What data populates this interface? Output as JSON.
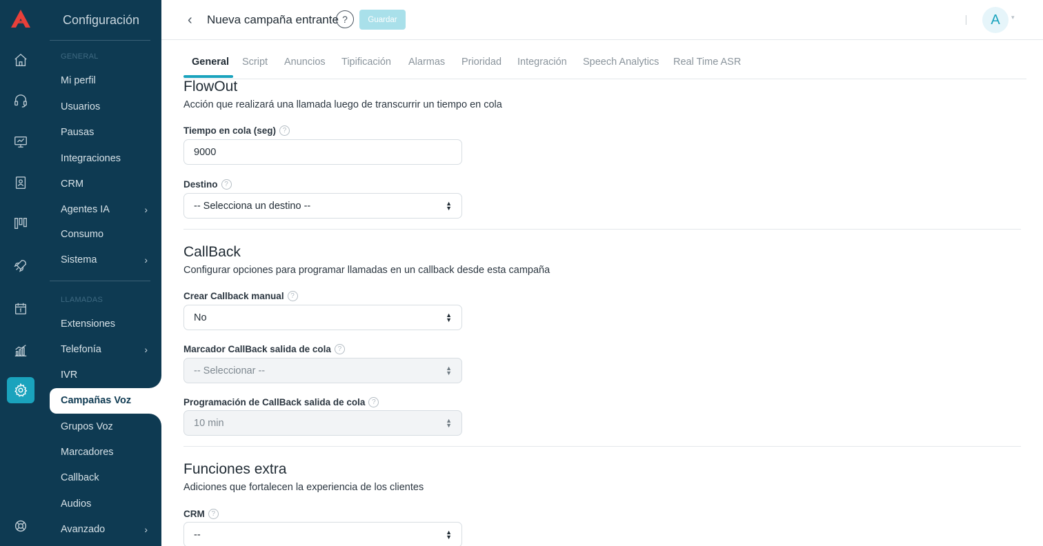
{
  "sidebar": {
    "title": "Configuración",
    "section_general": "GENERAL",
    "section_llamadas": "LLAMADAS",
    "general_items": [
      {
        "label": "Mi perfil",
        "chevron": false
      },
      {
        "label": "Usuarios",
        "chevron": false
      },
      {
        "label": "Pausas",
        "chevron": false
      },
      {
        "label": "Integraciones",
        "chevron": false
      },
      {
        "label": "CRM",
        "chevron": false
      },
      {
        "label": "Agentes IA",
        "chevron": true
      },
      {
        "label": "Consumo",
        "chevron": false
      },
      {
        "label": "Sistema",
        "chevron": true
      }
    ],
    "llamadas_items": [
      {
        "label": "Extensiones",
        "chevron": false
      },
      {
        "label": "Telefonía",
        "chevron": true
      },
      {
        "label": "IVR",
        "chevron": false
      },
      {
        "label": "Campañas Voz",
        "chevron": false,
        "active": true
      },
      {
        "label": "Grupos Voz",
        "chevron": false
      },
      {
        "label": "Marcadores",
        "chevron": false
      },
      {
        "label": "Callback",
        "chevron": false
      },
      {
        "label": "Audios",
        "chevron": false
      },
      {
        "label": "Avanzado",
        "chevron": true
      }
    ],
    "chevron_glyph": "›"
  },
  "rail_icons": [
    "home-icon",
    "headset-icon",
    "monitor-icon",
    "contacts-icon",
    "kanban-icon",
    "rocket-icon",
    "calendar-icon",
    "chart-icon",
    "gear-icon",
    "support-icon"
  ],
  "header": {
    "back_glyph": "‹",
    "title": "Nueva campaña entrante",
    "help_glyph": "?",
    "save_label": "Guardar",
    "avatar_letter": "A",
    "caret": "▾"
  },
  "tabs": [
    {
      "label": "General",
      "active": true
    },
    {
      "label": "Script"
    },
    {
      "label": "Anuncios"
    },
    {
      "label": "Tipificación"
    },
    {
      "label": "Alarmas"
    },
    {
      "label": "Prioridad"
    },
    {
      "label": "Integración"
    },
    {
      "label": "Speech Analytics"
    },
    {
      "label": "Real Time ASR"
    }
  ],
  "flowout": {
    "title": "FlowOut",
    "description": "Acción que realizará una llamada luego de transcurrir un tiempo en cola",
    "queue_time_label": "Tiempo en cola (seg)",
    "queue_time_value": "9000",
    "destino_label": "Destino",
    "destino_value": "-- Selecciona un destino --"
  },
  "callback": {
    "title": "CallBack",
    "description": "Configurar opciones para programar llamadas en un callback desde esta campaña",
    "manual_label": "Crear Callback manual",
    "manual_value": "No",
    "marcador_label": "Marcador CallBack salida de cola",
    "marcador_value": "-- Seleccionar --",
    "programacion_label": "Programación de CallBack salida de cola",
    "programacion_value": "10 min"
  },
  "extra": {
    "title": "Funciones extra",
    "description": "Adiciones que fortalecen la experiencia de los clientes",
    "crm_label": "CRM",
    "crm_value": "--"
  },
  "help_glyph": "?",
  "colors": {
    "sidebar_bg": "#0e3a52",
    "accent": "#1aa3bd",
    "save_disabled": "#a9e0ea",
    "logo": "#e8403a"
  }
}
